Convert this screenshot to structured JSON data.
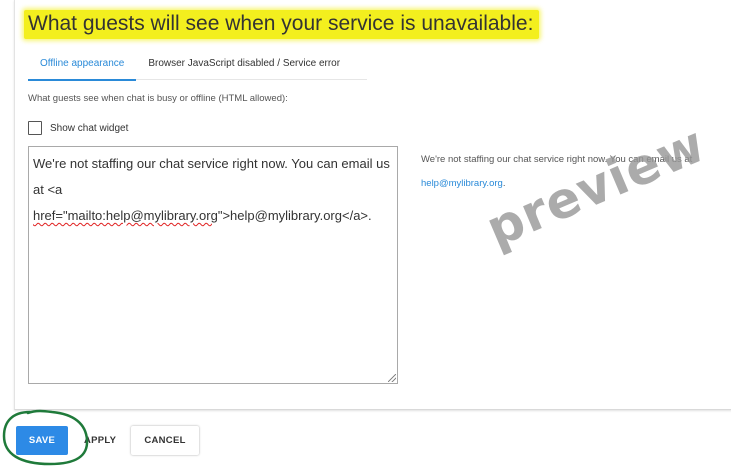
{
  "heading": "What guests will see when your service is unavailable:",
  "tabs": [
    {
      "label": "Offline appearance",
      "active": true
    },
    {
      "label": "Browser JavaScript disabled / Service error",
      "active": false
    }
  ],
  "field_label": "What guests see when chat is busy or offline (HTML allowed):",
  "show_widget": {
    "label": "Show chat widget",
    "checked": false
  },
  "editor": {
    "line1": "We're not staffing our chat service right now.  You can email us",
    "line2_prefix": "at <a ",
    "line2_misspelled": "href=\"mailto:help@mylibrary.org",
    "line2_suffix": "\">help@mylibrary.org</a>."
  },
  "preview": {
    "text": "We're not staffing our chat service right now. You can email us at",
    "link": "help@mylibrary.org",
    "trailing": "."
  },
  "watermark": "preview",
  "buttons": {
    "save": "SAVE",
    "apply": "APPLY",
    "cancel": "CANCEL"
  },
  "colors": {
    "accent": "#2a8ad8",
    "highlight": "#f3ef1e",
    "save_button": "#2d8ae6",
    "annotation": "#1f7a3a"
  }
}
